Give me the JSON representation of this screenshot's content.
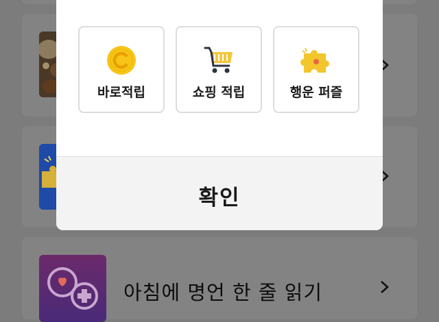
{
  "background_list": {
    "item_3_title": "아침에 명언 한 줄 읽기"
  },
  "dialog": {
    "options": [
      {
        "label": "바로적립",
        "icon": "coin-icon"
      },
      {
        "label": "쇼핑 적립",
        "icon": "shopping-cart-icon"
      },
      {
        "label": "행운 퍼즐",
        "icon": "puzzle-piece-icon"
      }
    ],
    "confirm_label": "확인"
  },
  "colors": {
    "overlay": "#7c7c7c",
    "coin": "#f6c518",
    "cart": "#f3c73a",
    "puzzle": "#f2c62c",
    "dialog": "#ffffff",
    "footer": "#f3f3f3"
  }
}
